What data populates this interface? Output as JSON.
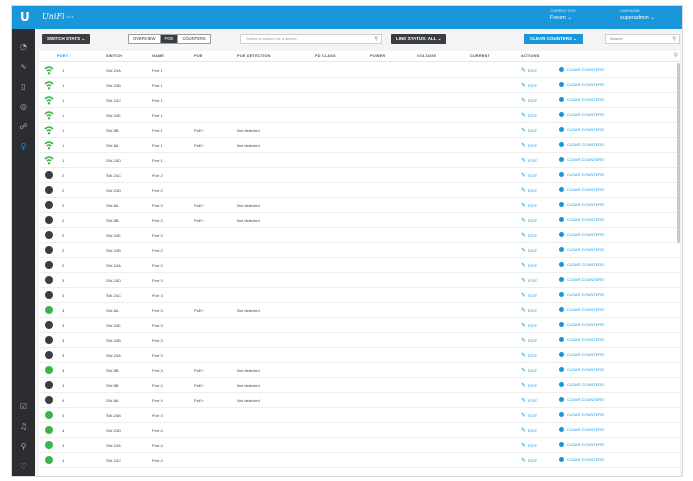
{
  "topbar": {
    "logo": "U",
    "brand": "UniFi",
    "version": "5.x.x",
    "site_caption": "CURRENT SITE",
    "site_value": "Forum",
    "admin_caption": "USERNAME",
    "admin_value": "superadmin"
  },
  "sidebar": {
    "icons": [
      "dashboard-icon",
      "statistics-icon",
      "map-icon",
      "devices-icon",
      "clients-icon",
      "insights-icon",
      "alerts-icon",
      "events-icon",
      "search-icon",
      "chat-icon"
    ]
  },
  "toolbar": {
    "switch_stats": "SWITCH STATS",
    "tabs": [
      "OVERVIEW",
      "POE",
      "COUNTERS"
    ],
    "search_placeholder": "Select or search for a device",
    "link_status": "LINK STATUS: ALL",
    "clear_counters": "CLEAR COUNTERS",
    "search_small": "Search"
  },
  "table": {
    "headers": [
      "PORT ↑",
      "SWITCH",
      "NAME",
      "POE",
      "POE DETECTION",
      "PD CLASS",
      "POWER",
      "VOLTAGE",
      "CURRENT",
      "ACTIONS"
    ],
    "edit_label": "EDIT",
    "clear_label": "CLEAR COUNTERS",
    "rows": [
      {
        "status": "wifi",
        "port": "1",
        "switch": "SW-24A",
        "name": "Port 1",
        "poe": "",
        "detection": ""
      },
      {
        "status": "wifi",
        "port": "1",
        "switch": "SW-24B",
        "name": "Port 1",
        "poe": "",
        "detection": ""
      },
      {
        "status": "wifi",
        "port": "1",
        "switch": "SW-24C",
        "name": "Port 1",
        "poe": "",
        "detection": ""
      },
      {
        "status": "wifi",
        "port": "1",
        "switch": "SW-24E",
        "name": "Port 1",
        "poe": "",
        "detection": ""
      },
      {
        "status": "wifi",
        "port": "1",
        "switch": "SW-8B",
        "name": "Port 1",
        "poe": "PoE+",
        "detection": "Not detected"
      },
      {
        "status": "wifi",
        "port": "1",
        "switch": "SW-8A",
        "name": "Port 1",
        "poe": "PoE+",
        "detection": "Not detected"
      },
      {
        "status": "wifi",
        "port": "1",
        "switch": "SW-24D",
        "name": "Port 1",
        "poe": "",
        "detection": ""
      },
      {
        "status": "down",
        "port": "2",
        "switch": "SW-24C",
        "name": "Port 2",
        "poe": "",
        "detection": ""
      },
      {
        "status": "down",
        "port": "2",
        "switch": "SW-24D",
        "name": "Port 2",
        "poe": "",
        "detection": ""
      },
      {
        "status": "down",
        "port": "2",
        "switch": "SW-8A",
        "name": "Port 2",
        "poe": "PoE+",
        "detection": "Not detected"
      },
      {
        "status": "down",
        "port": "2",
        "switch": "SW-8B",
        "name": "Port 2",
        "poe": "PoE+",
        "detection": "Not detected"
      },
      {
        "status": "down",
        "port": "2",
        "switch": "SW-24E",
        "name": "Port 2",
        "poe": "",
        "detection": ""
      },
      {
        "status": "down",
        "port": "2",
        "switch": "SW-24B",
        "name": "Port 2",
        "poe": "",
        "detection": ""
      },
      {
        "status": "down",
        "port": "2",
        "switch": "SW-24A",
        "name": "Port 2",
        "poe": "",
        "detection": ""
      },
      {
        "status": "down",
        "port": "3",
        "switch": "SW-24D",
        "name": "Port 3",
        "poe": "",
        "detection": ""
      },
      {
        "status": "down",
        "port": "3",
        "switch": "SW-24C",
        "name": "Port 3",
        "poe": "",
        "detection": ""
      },
      {
        "status": "up",
        "port": "3",
        "switch": "SW-8A",
        "name": "Port 3",
        "poe": "PoE+",
        "detection": "Not detected"
      },
      {
        "status": "down",
        "port": "3",
        "switch": "SW-24E",
        "name": "Port 3",
        "poe": "",
        "detection": ""
      },
      {
        "status": "down",
        "port": "3",
        "switch": "SW-24B",
        "name": "Port 3",
        "poe": "",
        "detection": ""
      },
      {
        "status": "down",
        "port": "3",
        "switch": "SW-24A",
        "name": "Port 3",
        "poe": "",
        "detection": ""
      },
      {
        "status": "up",
        "port": "3",
        "switch": "SW-8B",
        "name": "Port 3",
        "poe": "PoE+",
        "detection": "Not detected"
      },
      {
        "status": "down",
        "port": "4",
        "switch": "SW-8B",
        "name": "Port 4",
        "poe": "PoE+",
        "detection": "Not detected"
      },
      {
        "status": "down",
        "port": "4",
        "switch": "SW-8A",
        "name": "Port 4",
        "poe": "PoE+",
        "detection": "Not detected"
      },
      {
        "status": "up",
        "port": "4",
        "switch": "SW-24B",
        "name": "Port 4",
        "poe": "",
        "detection": ""
      },
      {
        "status": "up",
        "port": "4",
        "switch": "SW-24D",
        "name": "Port 4",
        "poe": "",
        "detection": ""
      },
      {
        "status": "up",
        "port": "4",
        "switch": "SW-24A",
        "name": "Port 4",
        "poe": "",
        "detection": ""
      },
      {
        "status": "up",
        "port": "4",
        "switch": "SW-24C",
        "name": "Port 4",
        "poe": "",
        "detection": ""
      }
    ]
  },
  "colors": {
    "accent": "#1a96db",
    "sidebar": "#2b2d31",
    "port_up": "#3bb54a",
    "port_down": "#3a3d42"
  }
}
